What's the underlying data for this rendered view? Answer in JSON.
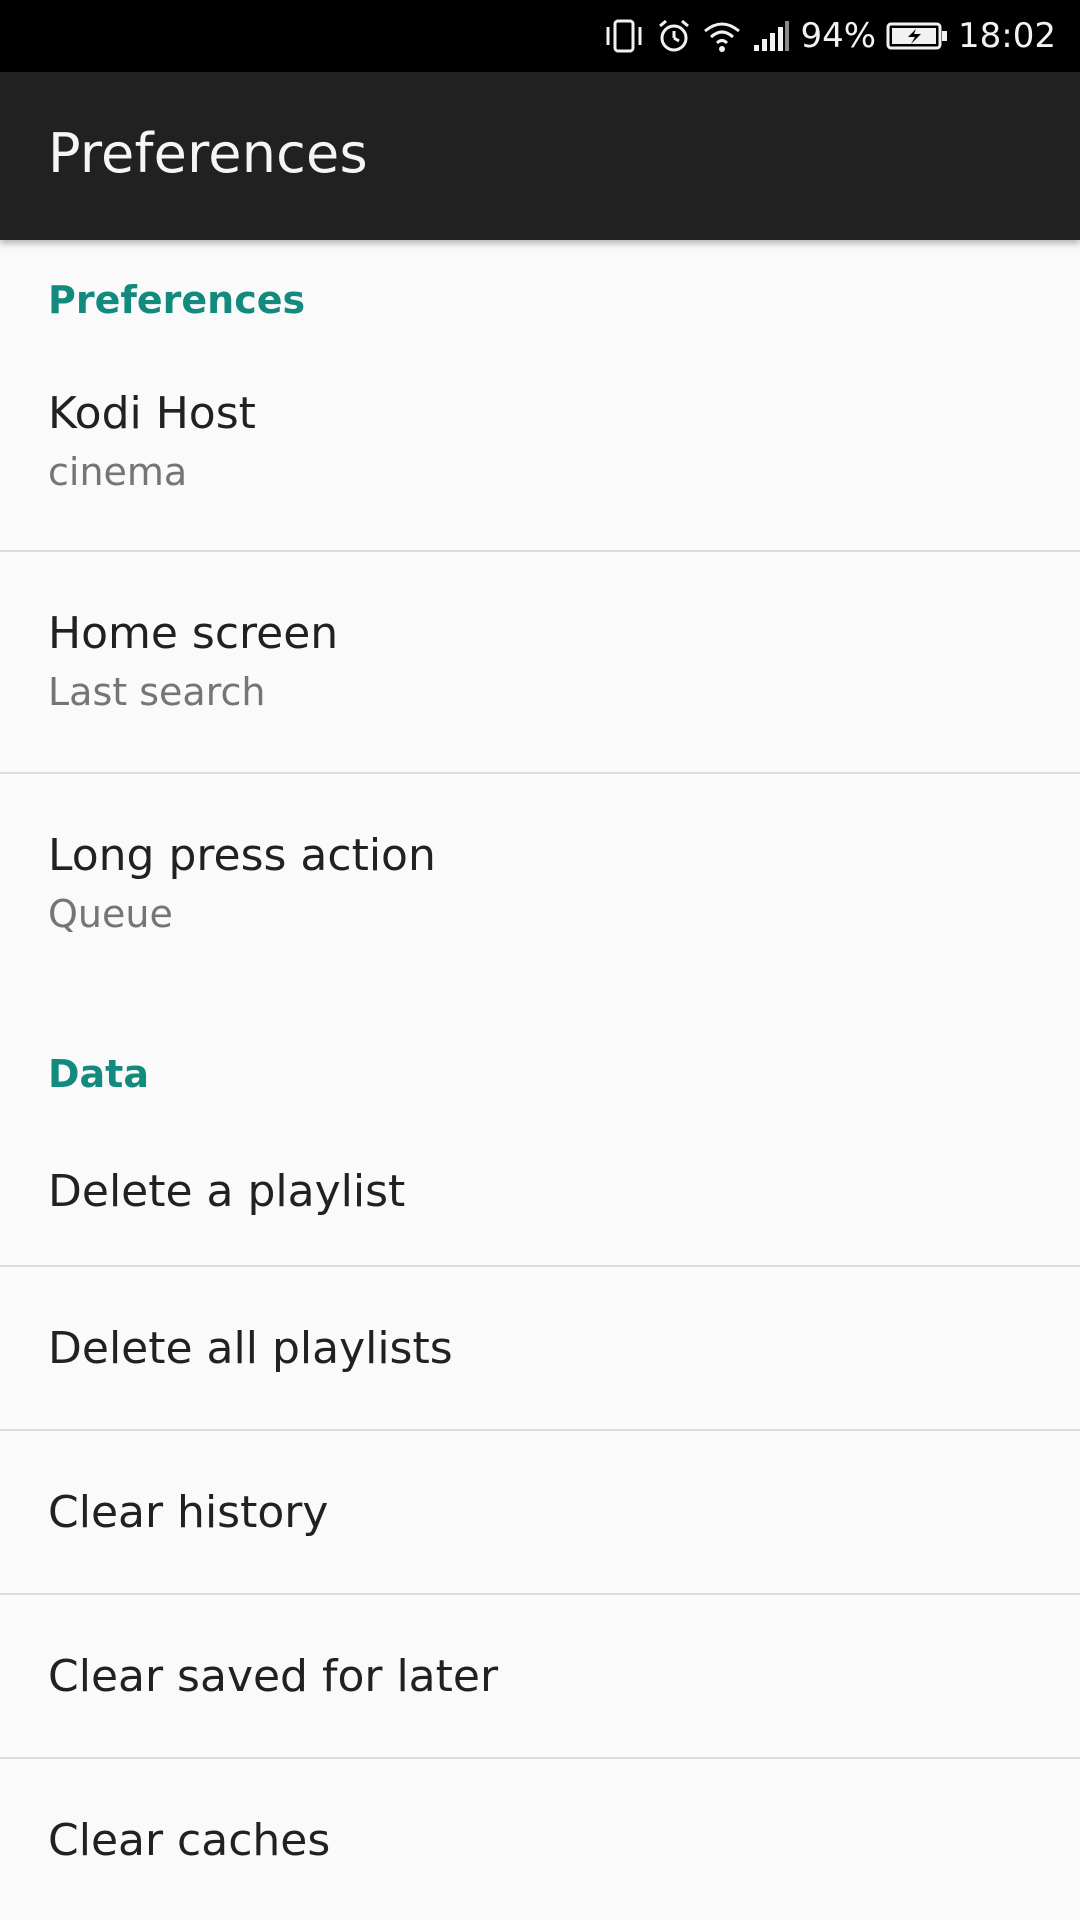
{
  "status_bar": {
    "battery_percent": "94%",
    "time": "18:02",
    "icons": [
      "vibrate-icon",
      "alarm-icon",
      "wifi-icon",
      "signal-icon",
      "battery-charging-icon"
    ]
  },
  "app_bar": {
    "title": "Preferences"
  },
  "sections": {
    "preferences": {
      "header": "Preferences",
      "items": [
        {
          "title": "Kodi Host",
          "summary": "cinema"
        },
        {
          "title": "Home screen",
          "summary": "Last search"
        },
        {
          "title": "Long press action",
          "summary": "Queue"
        }
      ]
    },
    "data": {
      "header": "Data",
      "items": [
        {
          "title": "Delete a playlist"
        },
        {
          "title": "Delete all playlists"
        },
        {
          "title": "Clear history"
        },
        {
          "title": "Clear saved for later"
        },
        {
          "title": "Clear caches"
        }
      ]
    }
  },
  "colors": {
    "accent": "#138a7e",
    "app_bar": "#212121",
    "status_bar": "#000000",
    "background": "#fafafa"
  }
}
